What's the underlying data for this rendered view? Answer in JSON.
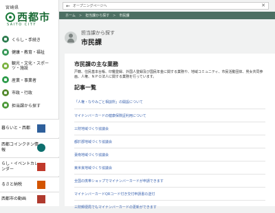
{
  "logo": {
    "prefecture": "宮崎県",
    "city": "西都市",
    "roman": "SAITO CITY"
  },
  "sidebar": {
    "items": [
      {
        "label": "くらし・手続き",
        "icon": "house-icon",
        "color": "#2e7d4f"
      },
      {
        "label": "健康・教育・福祉",
        "icon": "heart-icon",
        "color": "#3b9a5a"
      },
      {
        "label": "観光・文化・スポーツ・施設",
        "icon": "camera-icon",
        "color": "#7cb342"
      },
      {
        "label": "産業・事業者",
        "icon": "factory-icon",
        "color": "#2e9c4b"
      },
      {
        "label": "市政・行政",
        "icon": "building-icon",
        "color": "#558b2f"
      },
      {
        "label": "担当課から探す",
        "icon": "person-icon",
        "color": "#4e9a3a"
      }
    ],
    "banners": [
      {
        "label": "暮らいと・西都",
        "icon": "book-icon",
        "color": "#2e5f9b"
      },
      {
        "label": "西都コインクチン情報",
        "icon": "badge-icon",
        "color": "#0d6f6e"
      },
      {
        "label": "らし・イベントカレンダー",
        "icon": "calendar-icon",
        "color": "#c0392b"
      },
      {
        "label": "るさと納税",
        "icon": "gift-icon",
        "color": "#d35400"
      },
      {
        "label": "西都市の動画",
        "icon": "video-icon",
        "color": "#b03a2e"
      }
    ]
  },
  "topbar": {
    "skip_label": "オープニングページへ",
    "crumbs": [
      "ホーム",
      "担当課から探す",
      "市民課"
    ]
  },
  "section": {
    "sub": "担当課から探す",
    "title": "市民課"
  },
  "panel": {
    "heading": "市民課の主な業務",
    "description": "戸籍、住民基本台帳、印鑑登録、外国人登録及び国民年金に関する業務や、地域コミュニティ、市民活動団体、男女共同参画、人権、ＮＰＯ法人に関する業務を行っています。",
    "articles_heading": "記事一覧",
    "articles": [
      "「人権・なやみごと相談所」の開設について",
      "マイナンバーカードの健康保険証利用について",
      "三財地域づくり協議会",
      "都於郡地域づくり協議会",
      "妻南地域づくり協議会",
      "東米良地域づくり協議会",
      "全国の携帯ショップでマイナンバーカードが申請できます",
      "マイナンバーカードQRコード付き交付申請書の送付",
      "三財郵便局でもマイナンバーカードの更新ができます"
    ]
  }
}
